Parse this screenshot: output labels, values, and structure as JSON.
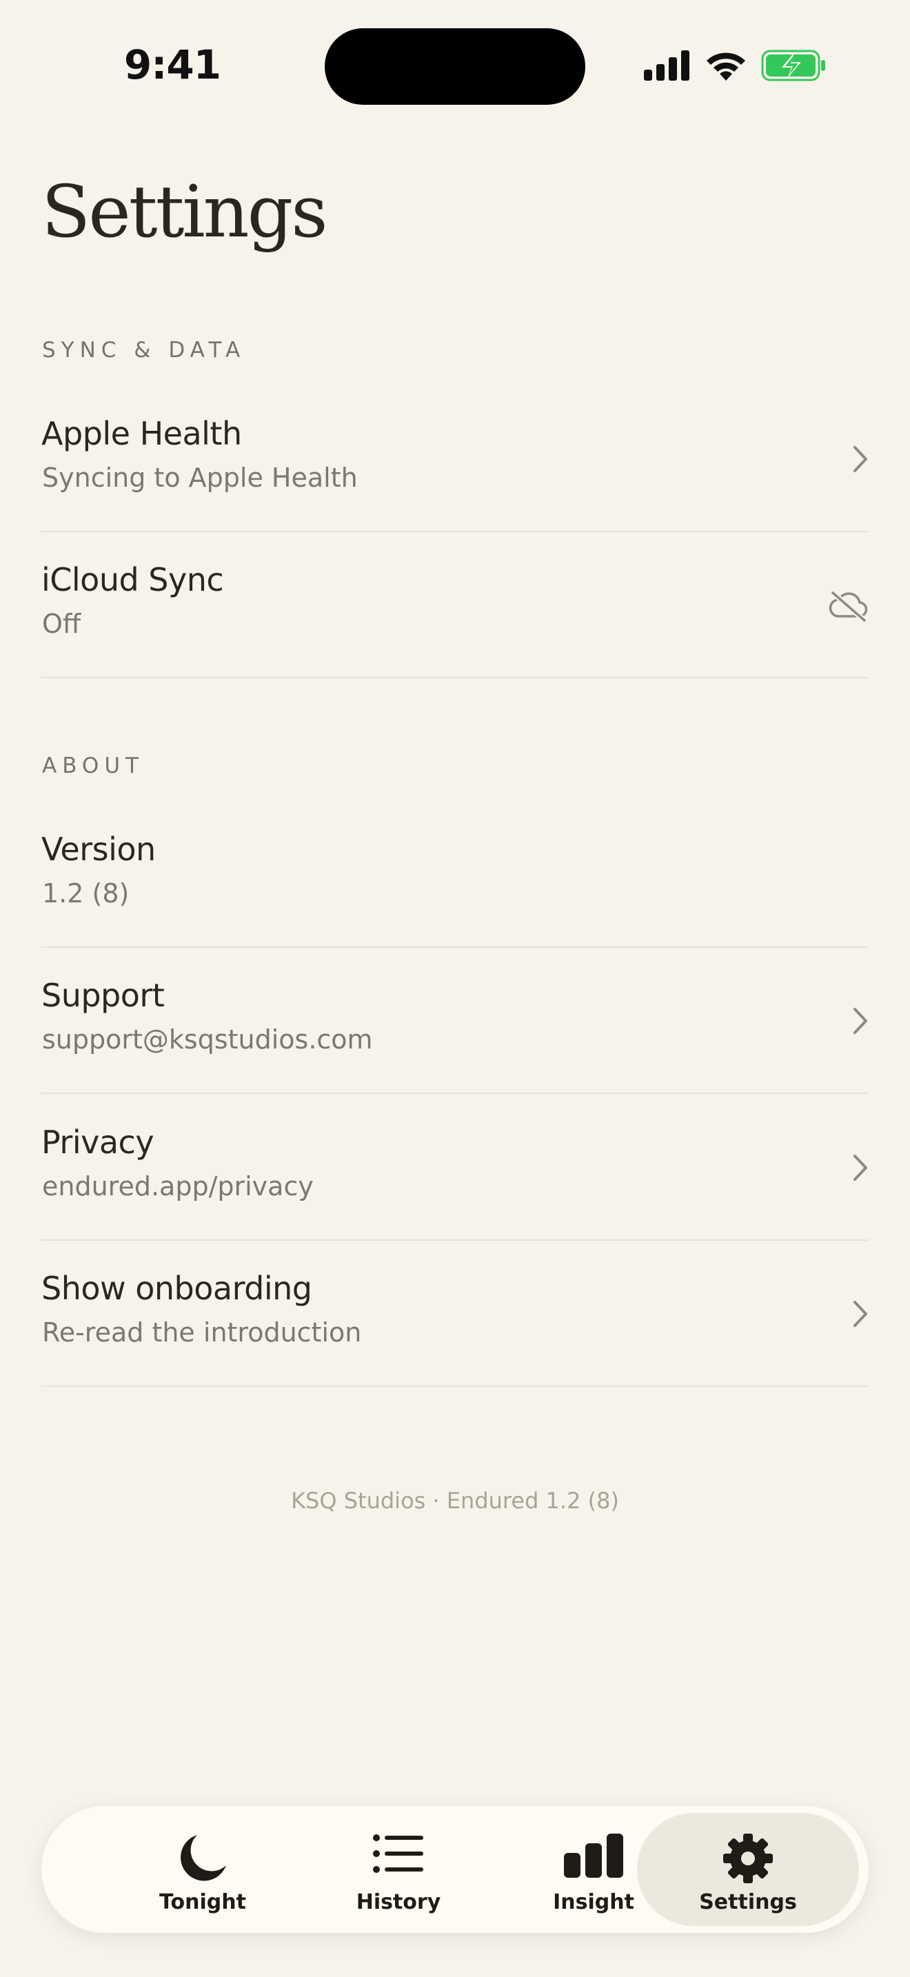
{
  "status_bar": {
    "time": "9:41",
    "icons": [
      "signal-icon",
      "wifi-icon",
      "battery-charging-icon"
    ]
  },
  "page": {
    "title": "Settings"
  },
  "sections": [
    {
      "label": "SYNC & DATA",
      "rows": [
        {
          "title": "Apple Health",
          "subtitle": "Syncing to Apple Health",
          "accessory": "chevron-right-icon"
        },
        {
          "title": "iCloud Sync",
          "subtitle": "Off",
          "accessory": "cloud-off-icon"
        }
      ]
    },
    {
      "label": "ABOUT",
      "rows": [
        {
          "title": "Version",
          "subtitle": "1.2 (8)",
          "accessory": "none"
        },
        {
          "title": "Support",
          "subtitle": "support@ksqstudios.com",
          "accessory": "chevron-right-icon"
        },
        {
          "title": "Privacy",
          "subtitle": "endured.app/privacy",
          "accessory": "chevron-right-icon"
        },
        {
          "title": "Show onboarding",
          "subtitle": "Re-read the introduction",
          "accessory": "chevron-right-icon"
        }
      ]
    }
  ],
  "footer": "KSQ Studios · Endured 1.2 (8)",
  "tab_bar": {
    "tabs": [
      {
        "label": "Tonight",
        "icon": "moon-icon",
        "active": false
      },
      {
        "label": "History",
        "icon": "list-icon",
        "active": false
      },
      {
        "label": "Insight",
        "icon": "bar-chart-icon",
        "active": false
      },
      {
        "label": "Settings",
        "icon": "gear-icon",
        "active": true
      }
    ]
  },
  "colors": {
    "background": "#F7F3EB",
    "text_primary": "#2A2722",
    "text_secondary": "#7C7870",
    "divider": "#E8E3D8",
    "battery_green": "#34C759",
    "tab_bar_bg": "#FDFBF3",
    "tab_active_bg": "#ECE8DD"
  }
}
